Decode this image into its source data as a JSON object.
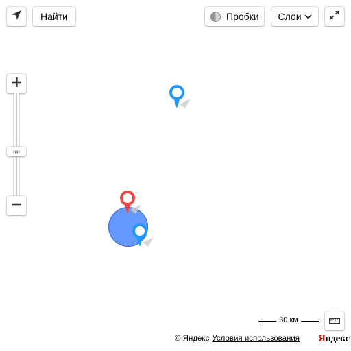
{
  "toolbar": {
    "locate_icon": "navigation-arrow-icon",
    "find_label": "Найти",
    "traffic_label": "Пробки",
    "traffic_icon": "traffic-light-icon",
    "layers_label": "Слои",
    "layers_icon": "chevron-down-icon",
    "fullscreen_icon": "expand-arrows-icon"
  },
  "zoom": {
    "plus_icon": "plus-icon",
    "minus_icon": "minus-icon",
    "level_fraction": 0.5
  },
  "markers": [
    {
      "color": "#1e98ff",
      "icon": "placemark-icon"
    },
    {
      "color": "#ed4543",
      "icon": "placemark-icon"
    },
    {
      "color": "#1e98ff",
      "icon": "placemark-icon"
    }
  ],
  "circle": {
    "fill": "#6699ff",
    "stroke": "#3b5fbf"
  },
  "scale": {
    "label": "30 км"
  },
  "ruler": {
    "icon": "ruler-icon"
  },
  "footer": {
    "copyright": "© Яндекс",
    "terms": "Условия использования",
    "logo_first": "Я",
    "logo_rest": "ндекс"
  },
  "colors": {
    "logo_red": "#e61400",
    "marker_blue": "#1e98ff",
    "marker_red": "#ed4543"
  }
}
